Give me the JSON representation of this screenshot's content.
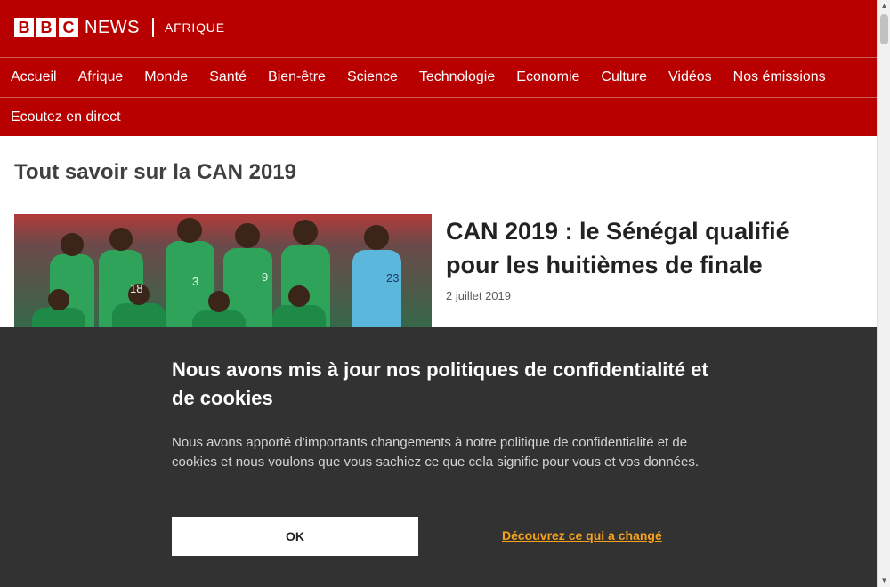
{
  "header": {
    "logo_letters": [
      "B",
      "B",
      "C"
    ],
    "logo_news": "NEWS",
    "service_name": "AFRIQUE",
    "brand_color": "#b80000"
  },
  "nav": {
    "items": [
      "Accueil",
      "Afrique",
      "Monde",
      "Santé",
      "Bien-être",
      "Science",
      "Technologie",
      "Economie",
      "Culture",
      "Vidéos",
      "Nos émissions"
    ],
    "secondary": "Ecoutez en direct"
  },
  "main": {
    "section_title": "Tout savoir sur la CAN 2019",
    "story": {
      "headline": "CAN 2019 : le Sénégal qualifié pour les huitièmes de finale",
      "date": "2 juillet 2019",
      "image_alt": "team-photo"
    }
  },
  "consent": {
    "title": "Nous avons mis à jour nos politiques de confidentialité et de cookies",
    "body": "Nous avons apporté d'importants changements à notre politique de confidentialité et de cookies et nous voulons que vous sachiez ce que cela signifie pour vous et vos données.",
    "ok_label": "OK",
    "link_label": "Découvrez ce qui a changé",
    "link_color": "#f6a21d"
  },
  "icons": {
    "scroll_up": "scroll-up-arrow-icon",
    "scroll_down": "scroll-down-arrow-icon"
  }
}
